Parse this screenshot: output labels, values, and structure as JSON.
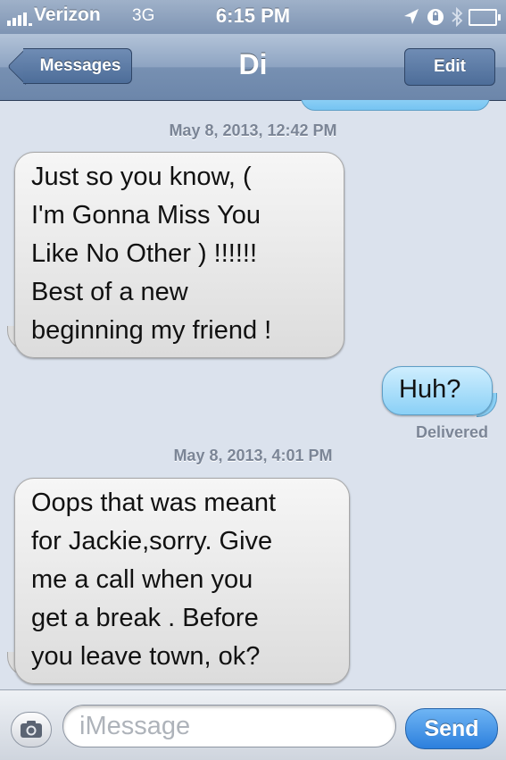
{
  "status_bar": {
    "carrier": "Verizon",
    "network": "3G",
    "time": "6:15 PM",
    "icons": [
      "signal-bars-icon",
      "location-arrow-icon",
      "lock-rotation-icon",
      "bluetooth-icon",
      "battery-icon"
    ]
  },
  "nav": {
    "back_label": "Messages",
    "title": "Di",
    "edit_label": "Edit"
  },
  "thread": {
    "timestamps": [
      "May 8, 2013, 12:42 PM",
      "May 8, 2013, 4:01 PM"
    ],
    "messages": [
      {
        "direction": "incoming",
        "lines": [
          "Just so you know,  (",
          "I'm Gonna Miss You",
          "Like No Other ) !!!!!!",
          "Best of a new",
          "beginning my friend !"
        ]
      },
      {
        "direction": "outgoing",
        "lines": [
          "Huh?"
        ]
      },
      {
        "direction": "incoming",
        "lines": [
          "Oops that was meant",
          "for Jackie,sorry. Give",
          "me a call when you",
          "get a break . Before",
          "you leave town, ok?"
        ]
      }
    ],
    "delivered": "Delivered"
  },
  "composer": {
    "placeholder": "iMessage",
    "send_label": "Send",
    "camera_icon": "camera-icon"
  },
  "colors": {
    "background": "#dbe2ed",
    "outgoing_bubble": "#8ad0f6",
    "incoming_bubble": "#dcdcdc",
    "send_button": "#2c7fdd"
  }
}
